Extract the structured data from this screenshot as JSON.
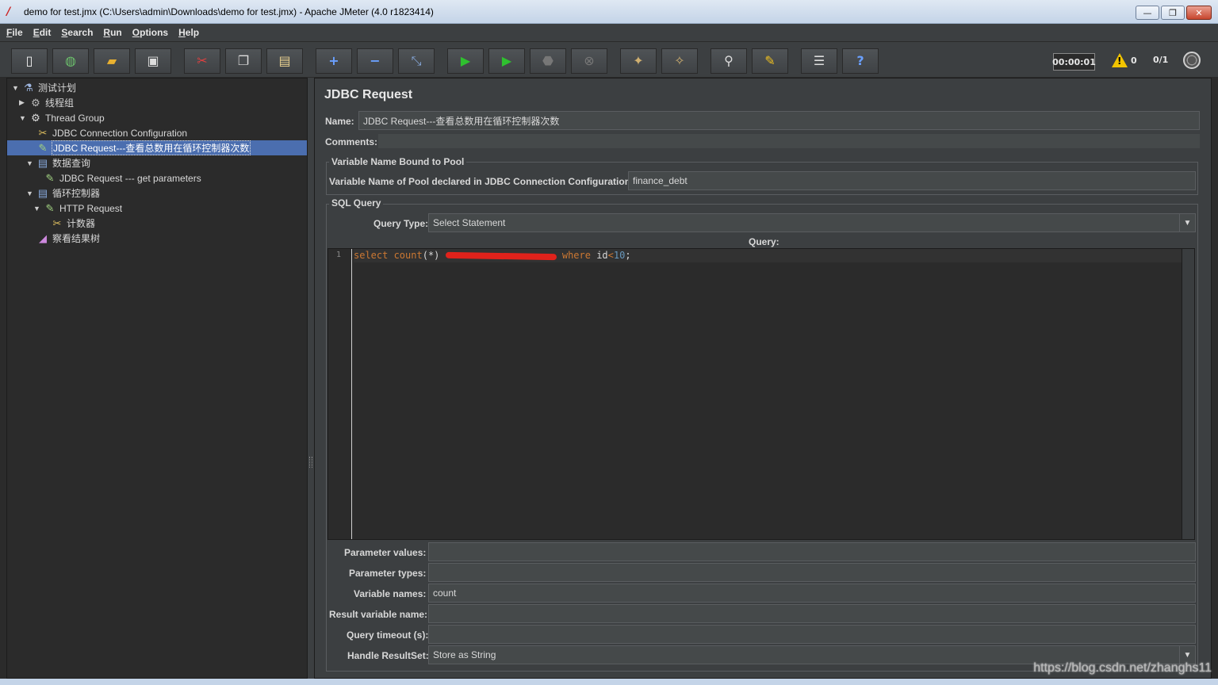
{
  "window": {
    "title": "demo for test.jmx (C:\\Users\\admin\\Downloads\\demo for test.jmx) - Apache JMeter (4.0 r1823414)",
    "buttons": [
      "—",
      "❐",
      "✕"
    ]
  },
  "menu": [
    {
      "u": "F",
      "rest": "ile"
    },
    {
      "u": "E",
      "rest": "dit"
    },
    {
      "u": "S",
      "rest": "earch"
    },
    {
      "u": "R",
      "rest": "un"
    },
    {
      "u": "O",
      "rest": "ptions"
    },
    {
      "u": "H",
      "rest": "elp"
    }
  ],
  "toolbar": {
    "timer": "00:00:01",
    "warnings": "0",
    "threads": "0/1",
    "icons": [
      "new-icon",
      "templates-icon",
      "open-icon",
      "save-icon",
      "cut-icon",
      "copy-icon",
      "paste-icon",
      "expand-icon",
      "collapse-icon",
      "toggle-icon",
      "start-icon",
      "start-no-pause-icon",
      "stop-icon",
      "shutdown-icon",
      "clear-icon",
      "clear-all-icon",
      "search-icon",
      "reset-search-icon",
      "function-helper-icon",
      "help-icon"
    ]
  },
  "tree": [
    {
      "label": "测试计划",
      "indent": 0,
      "tog": "▼",
      "icon": "test-plan-icon",
      "glyph": "⚗",
      "color": "#9fb7e0"
    },
    {
      "label": "线程组",
      "indent": 1,
      "tog": "▶",
      "icon": "thread-group-icon",
      "glyph": "⚙",
      "color": "#bbbbbb"
    },
    {
      "label": "Thread Group",
      "indent": 1,
      "tog": "▼",
      "icon": "thread-group-icon",
      "glyph": "⚙",
      "color": "#dddddd"
    },
    {
      "label": "JDBC Connection Configuration",
      "indent": 2,
      "tog": "",
      "icon": "config-element-icon",
      "glyph": "✂",
      "color": "#e0c060"
    },
    {
      "label": "JDBC Request---查看总数用在循环控制器次数",
      "indent": 2,
      "tog": "",
      "icon": "sampler-icon",
      "glyph": "✎",
      "color": "#a0d080",
      "selected": true
    },
    {
      "label": "数据查询",
      "indent": 2,
      "tog": "▼",
      "icon": "controller-icon",
      "glyph": "▤",
      "color": "#88aadd"
    },
    {
      "label": "JDBC Request --- get parameters",
      "indent": 3,
      "tog": "",
      "icon": "sampler-icon",
      "glyph": "✎",
      "color": "#a0d080"
    },
    {
      "label": "循环控制器",
      "indent": 2,
      "tog": "▼",
      "icon": "controller-icon",
      "glyph": "▤",
      "color": "#88aadd"
    },
    {
      "label": "HTTP Request",
      "indent": 3,
      "tog": "▼",
      "icon": "sampler-icon",
      "glyph": "✎",
      "color": "#a0d080"
    },
    {
      "label": "计数器",
      "indent": 4,
      "tog": "",
      "icon": "config-element-icon",
      "glyph": "✂",
      "color": "#e0c060"
    },
    {
      "label": "察看结果树",
      "indent": 2,
      "tog": "",
      "icon": "listener-icon",
      "glyph": "◢",
      "color": "#cc88dd"
    }
  ],
  "panel": {
    "heading": "JDBC Request",
    "name_label": "Name:",
    "name_value": "JDBC Request---查看总数用在循环控制器次数",
    "comments_label": "Comments:",
    "comments_value": "",
    "pool_group_title": "Variable Name Bound to Pool",
    "pool_label": "Variable Name of Pool declared in JDBC Connection Configuration:",
    "pool_value": "finance_debt",
    "sql_group_title": "SQL Query",
    "query_type_label": "Query Type:",
    "query_type_value": "Select Statement",
    "query_label": "Query:",
    "line_number": "1",
    "code": {
      "kw1": "select",
      "fn": " count",
      "paren": "(*) ",
      "kw2": " where",
      "col": " id",
      "op": "<",
      "num": "10",
      "end": ";"
    },
    "param_values_label": "Parameter values:",
    "param_values_value": "",
    "param_types_label": "Parameter types:",
    "param_types_value": "",
    "var_names_label": "Variable names:",
    "var_names_value": "count",
    "result_var_label": "Result variable name:",
    "result_var_value": "",
    "timeout_label": "Query timeout (s):",
    "timeout_value": "",
    "handle_label": "Handle ResultSet:",
    "handle_value": "Store as String"
  },
  "watermark": "https://blog.csdn.net/zhanghs11"
}
